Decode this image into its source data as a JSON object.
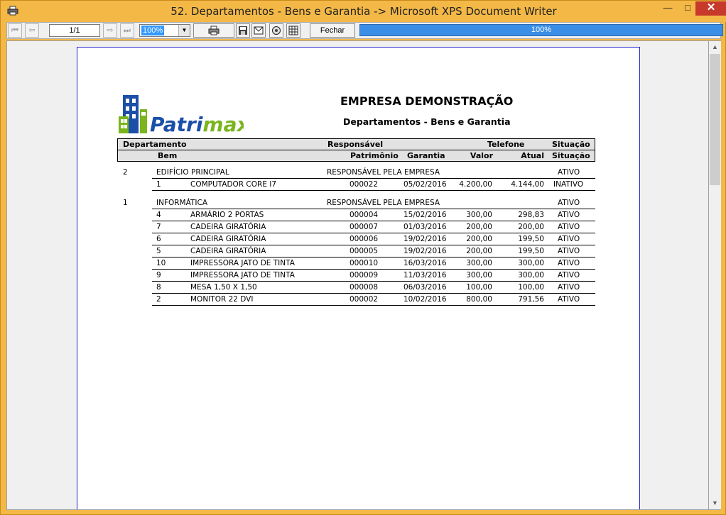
{
  "window": {
    "title": "52. Departamentos - Bens e Garantia -> Microsoft XPS Document Writer",
    "minimize": "—",
    "maximize": "□",
    "close": "✕"
  },
  "toolbar": {
    "first_icon": "first-page-icon",
    "prev_icon": "prev-page-icon",
    "page": "1/1",
    "next_icon": "next-page-icon",
    "last_icon": "last-page-icon",
    "zoom": "100%",
    "print_icon": "printer-icon",
    "save_icon": "save-icon",
    "email_icon": "email-icon",
    "export_icon": "export-icon",
    "setup_icon": "page-setup-icon",
    "close_label": "Fechar",
    "progress": "100%",
    "progress_fraction": 1.0
  },
  "report": {
    "company": "EMPRESA DEMONSTRAÇÃO",
    "title": "Departamentos - Bens e Garantia",
    "logo_text": "Patrimax",
    "header1": {
      "departamento": "Departamento",
      "responsavel": "Responsável",
      "telefone": "Telefone",
      "situacao": "Situação"
    },
    "header2": {
      "bem": "Bem",
      "patrimonio": "Patrimônio",
      "garantia": "Garantia",
      "valor": "Valor",
      "atual": "Atual",
      "situacao": "Situação"
    },
    "departments": [
      {
        "code": "2",
        "name": "EDIFÍCIO PRINCIPAL",
        "responsavel": "RESPONSÁVEL PELA EMPRESA",
        "situacao": "ATIVO",
        "items": [
          {
            "code": "1",
            "name": "COMPUTADOR CORE I7",
            "patrimonio": "000022",
            "garantia": "05/02/2016",
            "valor": "4.200,00",
            "atual": "4.144,00",
            "situacao": "INATIVO"
          }
        ]
      },
      {
        "code": "1",
        "name": "INFORMÁTICA",
        "responsavel": "RESPONSÁVEL PELA EMPRESA",
        "situacao": "ATIVO",
        "items": [
          {
            "code": "4",
            "name": "ARMÁRIO 2 PORTAS",
            "patrimonio": "000004",
            "garantia": "15/02/2016",
            "valor": "300,00",
            "atual": "298,83",
            "situacao": "ATIVO"
          },
          {
            "code": "7",
            "name": "CADEIRA GIRATÓRIA",
            "patrimonio": "000007",
            "garantia": "01/03/2016",
            "valor": "200,00",
            "atual": "200,00",
            "situacao": "ATIVO"
          },
          {
            "code": "6",
            "name": "CADEIRA GIRATÓRIA",
            "patrimonio": "000006",
            "garantia": "19/02/2016",
            "valor": "200,00",
            "atual": "199,50",
            "situacao": "ATIVO"
          },
          {
            "code": "5",
            "name": "CADEIRA GIRATÓRIA",
            "patrimonio": "000005",
            "garantia": "19/02/2016",
            "valor": "200,00",
            "atual": "199,50",
            "situacao": "ATIVO"
          },
          {
            "code": "10",
            "name": "IMPRESSORA JATO DE TINTA",
            "patrimonio": "000010",
            "garantia": "16/03/2016",
            "valor": "300,00",
            "atual": "300,00",
            "situacao": "ATIVO"
          },
          {
            "code": "9",
            "name": "IMPRESSORA JATO DE TINTA",
            "patrimonio": "000009",
            "garantia": "11/03/2016",
            "valor": "300,00",
            "atual": "300,00",
            "situacao": "ATIVO"
          },
          {
            "code": "8",
            "name": "MESA 1,50 X 1,50",
            "patrimonio": "000008",
            "garantia": "06/03/2016",
            "valor": "100,00",
            "atual": "100,00",
            "situacao": "ATIVO"
          },
          {
            "code": "2",
            "name": "MONITOR 22 DVI",
            "patrimonio": "000002",
            "garantia": "10/02/2016",
            "valor": "800,00",
            "atual": "791,56",
            "situacao": "ATIVO"
          }
        ]
      }
    ]
  }
}
